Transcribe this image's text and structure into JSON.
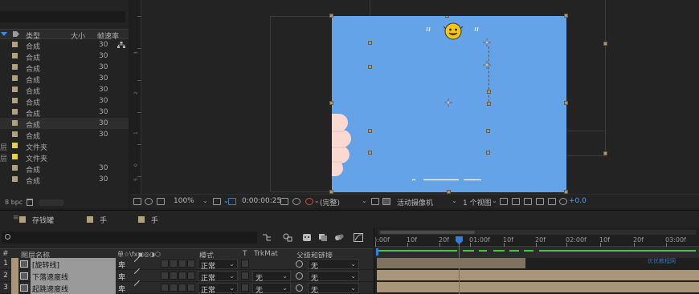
{
  "project": {
    "columns": {
      "type": "类型",
      "size": "大小",
      "rate": "帧速率"
    },
    "rows": [
      {
        "prefix": "",
        "type": "合成",
        "rate": "30",
        "label": "comp"
      },
      {
        "prefix": "",
        "type": "合成",
        "rate": "30",
        "label": "comp"
      },
      {
        "prefix": "",
        "type": "合成",
        "rate": "30",
        "label": "comp"
      },
      {
        "prefix": "",
        "type": "合成",
        "rate": "30",
        "label": "comp"
      },
      {
        "prefix": "",
        "type": "合成",
        "rate": "30",
        "label": "comp"
      },
      {
        "prefix": "",
        "type": "合成",
        "rate": "30",
        "label": "comp"
      },
      {
        "prefix": "",
        "type": "合成",
        "rate": "30",
        "label": "comp"
      },
      {
        "prefix": "",
        "type": "合成",
        "rate": "30",
        "label": "comp"
      },
      {
        "prefix": "",
        "type": "合成",
        "rate": "30",
        "label": "comp"
      },
      {
        "prefix": "层",
        "type": "文件夹",
        "rate": "",
        "label": "folder"
      },
      {
        "prefix": "层",
        "type": "文件夹",
        "rate": "",
        "label": "folder"
      },
      {
        "prefix": "",
        "type": "合成",
        "rate": "30",
        "label": "comp"
      },
      {
        "prefix": "",
        "type": "合成",
        "rate": "30",
        "label": "comp"
      }
    ],
    "bpc": "8 bpc"
  },
  "viewer": {
    "zoom": "100%",
    "timecode": "0:00:00:25",
    "resolution": "(完整)",
    "camera": "活动摄像机",
    "views": "1 个视图",
    "exposure": "+0.0",
    "ruler_ticks": [
      "3",
      "2",
      "1",
      "0",
      "5"
    ]
  },
  "tabs": [
    {
      "label": "存钱罐"
    },
    {
      "label": "手"
    },
    {
      "label": "手"
    }
  ],
  "timeline": {
    "search_placeholder": "",
    "header": {
      "num": "#",
      "name": "图层名称",
      "switches": "单☆\\fx▣◎◑⬡",
      "mode": "模式",
      "t": "T",
      "trkmat": "TrkMat",
      "parent": "父级和链接"
    },
    "layers": [
      {
        "num": "1",
        "name": "[旋转线]",
        "mode": "正常",
        "trkmat": "",
        "parent": "无"
      },
      {
        "num": "2",
        "name": "下落速度线",
        "mode": "正常",
        "trkmat": "无",
        "parent": "无"
      },
      {
        "num": "3",
        "name": "起跳速度线",
        "mode": "正常",
        "trkmat": "无",
        "parent": "无"
      }
    ],
    "ruler_labels": [
      "):00f",
      "10f",
      "20f",
      "01:00f",
      "10f",
      "20f",
      "02:00f",
      "10f",
      "20f",
      "03:00f"
    ],
    "watermark": "优优教程网"
  },
  "colors": {
    "comp_bg": "#64a3e8",
    "label_tan": "#b4a07a",
    "folder_yellow": "#e4d33f",
    "playhead_blue": "#2f7fe0",
    "keyframe_green": "#47c447"
  }
}
